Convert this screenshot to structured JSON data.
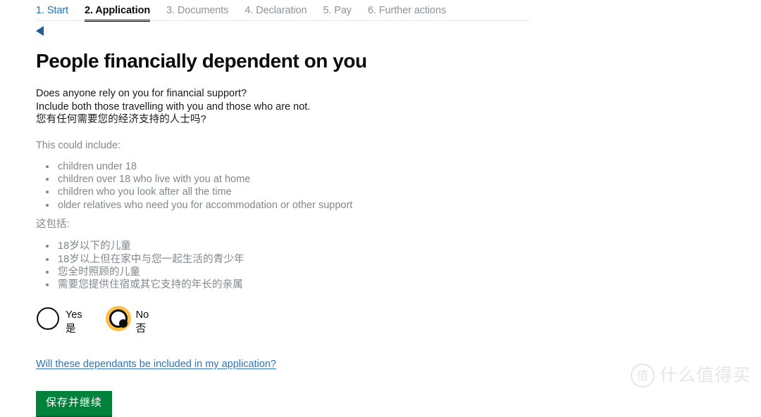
{
  "progress_nav": {
    "steps": [
      {
        "label": "1. Start",
        "state": "link"
      },
      {
        "label": "2. Application",
        "state": "active"
      },
      {
        "label": "3. Documents",
        "state": "muted"
      },
      {
        "label": "4. Declaration",
        "state": "muted"
      },
      {
        "label": "5. Pay",
        "state": "muted"
      },
      {
        "label": "6. Further actions",
        "state": "muted"
      }
    ]
  },
  "back": {
    "icon": "back-triangle-icon",
    "color": "#1d5c9e"
  },
  "main": {
    "title": "People financially dependent on you",
    "intro": {
      "line1": "Does anyone rely on you for financial support?",
      "line2": "Include both those travelling with you and those who are not.",
      "line3_cn": "您有任何需要您的经济支持的人士吗?"
    },
    "could_include_label": "This could include:",
    "could_include_items": [
      "children under 18",
      "children over 18 who live with you at home",
      "children who you look after all the time",
      "older relatives who need you for accommodation or other support"
    ],
    "could_include_label_cn": "这包括:",
    "could_include_items_cn": [
      "18岁以下的儿童",
      "18岁以上但在家中与您一起生活的青少年",
      "您全时照顾的儿童",
      "需要您提供住宿或其它支持的年长的亲属"
    ],
    "radios": [
      {
        "value": "yes",
        "label_en": "Yes",
        "label_cn": "是",
        "checked": false
      },
      {
        "value": "no",
        "label_en": "No",
        "label_cn": "否",
        "checked": true
      }
    ],
    "help_link": "Will these dependants be included in my application?",
    "submit_label": "保存并继续"
  },
  "watermark": {
    "badge": "值",
    "text": "什么值得买"
  },
  "colors": {
    "link": "#1d70b8",
    "help_link": "#2c73b7",
    "muted_text": "#81878b",
    "focus_ring": "#ffbf47",
    "submit_green": "#00823b",
    "text": "#0b0c0c"
  }
}
